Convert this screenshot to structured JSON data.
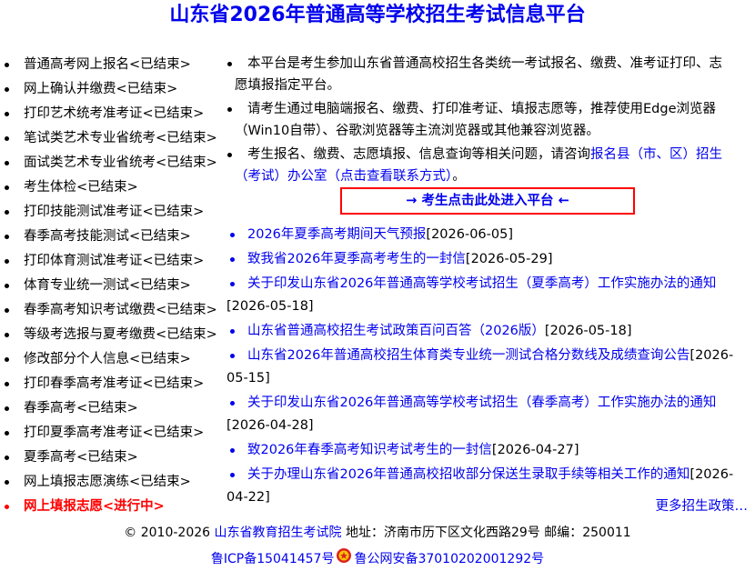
{
  "title": "山东省2026年普通高等学校招生考试信息平台",
  "sidebar": {
    "items": [
      {
        "label": "普通高考网上报名<已结束>",
        "active": false
      },
      {
        "label": "网上确认并缴费<已结束>",
        "active": false
      },
      {
        "label": "打印艺术统考准考证<已结束>",
        "active": false
      },
      {
        "label": "笔试类艺术专业省统考<已结束>",
        "active": false
      },
      {
        "label": "面试类艺术专业省统考<已结束>",
        "active": false
      },
      {
        "label": "考生体检<已结束>",
        "active": false
      },
      {
        "label": "打印技能测试准考证<已结束>",
        "active": false
      },
      {
        "label": "春季高考技能测试<已结束>",
        "active": false
      },
      {
        "label": "打印体育测试准考证<已结束>",
        "active": false
      },
      {
        "label": "体育专业统一测试<已结束>",
        "active": false
      },
      {
        "label": "春季高考知识考试缴费<已结束>",
        "active": false
      },
      {
        "label": "等级考选报与夏考缴费<已结束>",
        "active": false
      },
      {
        "label": "修改部分个人信息<已结束>",
        "active": false
      },
      {
        "label": "打印春季高考准考证<已结束>",
        "active": false
      },
      {
        "label": "春季高考<已结束>",
        "active": false
      },
      {
        "label": "打印夏季高考准考证<已结束>",
        "active": false
      },
      {
        "label": "夏季高考<已结束>",
        "active": false
      },
      {
        "label": "网上填报志愿演练<已结束>",
        "active": false
      },
      {
        "label": "网上填报志愿<进行中>",
        "active": true
      }
    ]
  },
  "notices": {
    "n1_line1": "本平台是考生参加山东省普通高校招生各类统一考试报名、缴费、准考证打印、志",
    "n1_line2": "愿填报指定平台。",
    "n2_line1": "请考生通过电脑端报名、缴费、打印准考证、填报志愿等，推荐使用Edge浏览器",
    "n2_line2": "（Win10自带）、谷歌浏览器等主流浏览器或其他兼容浏览器。",
    "n3_prefix": "考生报名、缴费、志愿填报、信息查询等相关问题，请咨询",
    "n3_link1": "报名县（市、区）招生",
    "n3_link2": "（考试）办公室（点击查看联系方式）",
    "n3_suffix": "。"
  },
  "enter_button": "→ 考生点击此处进入平台 ←",
  "news": [
    {
      "title": "2026年夏季高考期间天气预报",
      "date": "[2026-06-05]"
    },
    {
      "title": "致我省2026年夏季高考考生的一封信",
      "date": "[2026-05-29]"
    },
    {
      "title": "关于印发山东省2026年普通高等学校考试招生（夏季高考）工作实施办法的通知",
      "date": "[2026-05-18]"
    },
    {
      "title": "山东省普通高校招生考试政策百问百答（2026版）",
      "date": "[2026-05-18]"
    },
    {
      "title": "山东省2026年普通高校招生体育类专业统一测试合格分数线及成绩查询公告",
      "date_part1": "[2026-",
      "date_part2": "05-15]"
    },
    {
      "title": "关于印发山东省2026年普通高等学校考试招生（春季高考）工作实施办法的通知",
      "date": "[2026-04-28]"
    },
    {
      "title": "致2026年春季高考知识考试考生的一封信",
      "date": "[2026-04-27]"
    },
    {
      "title": "关于办理山东省2026年普通高校招收部分保送生录取手续等相关工作的通知",
      "date_part1": "[2026-",
      "date_part2": "04-22]"
    }
  ],
  "more_link": "更多招生政策…",
  "footer": {
    "copyright": "© 2010-2026",
    "org_link": "山东省教育招生考试院",
    "address": "地址：济南市历下区文化西路29号 邮编：250011",
    "icp": "鲁ICP备15041457号",
    "police": "鲁公网安备37010202001292号"
  },
  "colors": {
    "link": "#0000ee",
    "active": "#ff0000",
    "text": "#000000"
  },
  "icons": {
    "police_badge": "police-badge-icon"
  }
}
